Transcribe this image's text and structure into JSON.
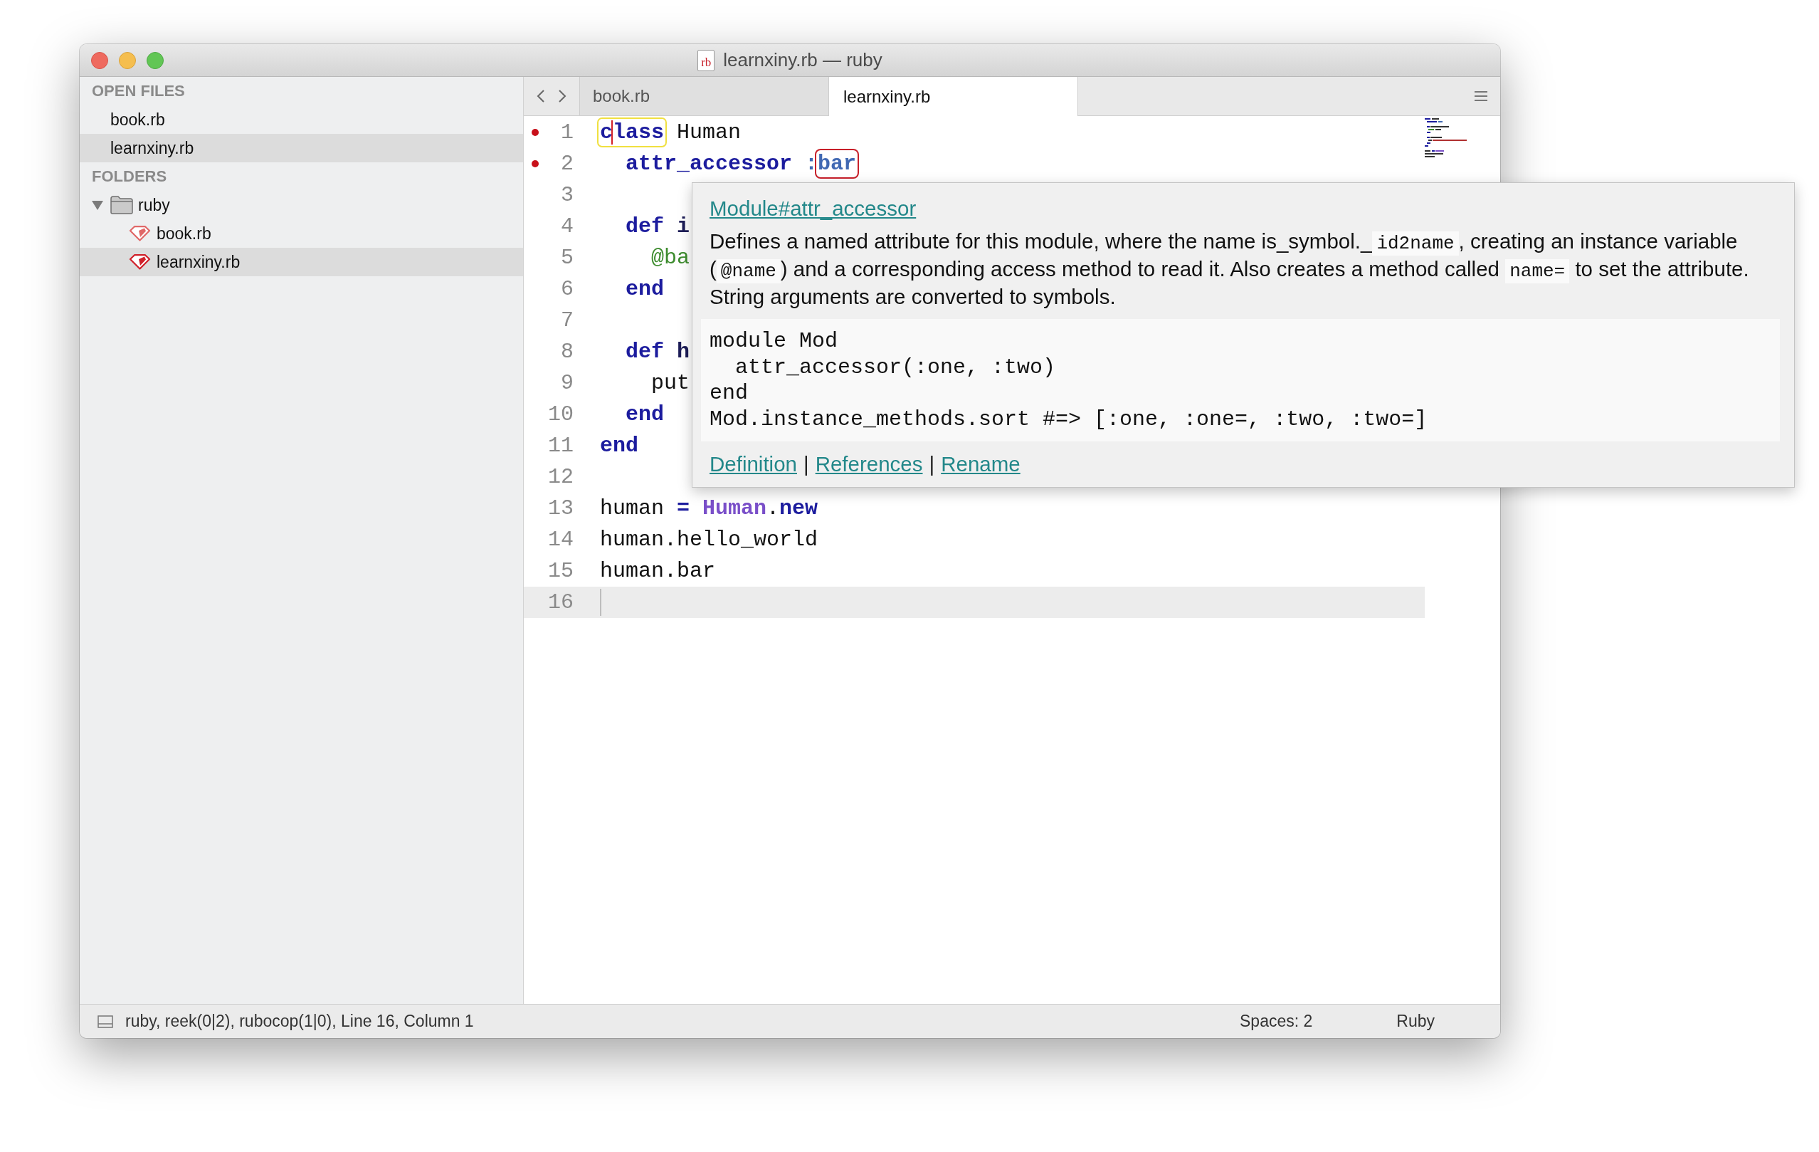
{
  "window": {
    "title": "learnxiny.rb — ruby",
    "file_icon_text": "rb"
  },
  "sidebar": {
    "sections": [
      {
        "kind": "open-files",
        "title": "OPEN FILES",
        "items": [
          {
            "label": "book.rb",
            "selected": false
          },
          {
            "label": "learnxiny.rb",
            "selected": true
          }
        ]
      },
      {
        "kind": "folders",
        "title": "FOLDERS",
        "items": [
          {
            "label": "ruby",
            "kind": "folder",
            "expanded": true,
            "selected": false,
            "children": [
              {
                "label": "book.rb",
                "kind": "ruby-file",
                "selected": false
              },
              {
                "label": "learnxiny.rb",
                "kind": "ruby-file",
                "selected": true
              }
            ]
          }
        ]
      }
    ]
  },
  "tabs": [
    {
      "label": "book.rb",
      "selected": false
    },
    {
      "label": "learnxiny.rb",
      "selected": true
    }
  ],
  "editor": {
    "lines": [
      {
        "number": "1",
        "marker": true,
        "current": false,
        "tokens": [
          {
            "text": "class ",
            "kind": "keyword",
            "matched": true,
            "flagged": false,
            "caret": true
          },
          {
            "text": "Human",
            "kind": "plain",
            "matched": false,
            "flagged": false,
            "caret": false
          }
        ]
      },
      {
        "number": "2",
        "marker": true,
        "current": false,
        "tokens": [
          {
            "text": "  attr_accessor ",
            "kind": "keyword",
            "matched": false,
            "flagged": false,
            "caret": false
          },
          {
            "text": ":",
            "kind": "symbol",
            "matched": false,
            "flagged": false,
            "caret": false
          },
          {
            "text": "bar",
            "kind": "symbol",
            "matched": false,
            "flagged": true,
            "caret": false
          }
        ]
      },
      {
        "number": "3",
        "marker": false,
        "current": false
      },
      {
        "number": "4",
        "marker": false,
        "current": false,
        "tokens": [
          {
            "text": "  def ",
            "kind": "keyword",
            "matched": false,
            "flagged": false,
            "caret": false
          },
          {
            "text": "i",
            "kind": "entity",
            "matched": false,
            "flagged": false,
            "caret": false
          }
        ]
      },
      {
        "number": "5",
        "marker": false,
        "current": false,
        "tokens": [
          {
            "text": "    @ba",
            "kind": "ivar",
            "matched": false,
            "flagged": false,
            "caret": false
          }
        ]
      },
      {
        "number": "6",
        "marker": false,
        "current": false,
        "tokens": [
          {
            "text": "  end",
            "kind": "keyword",
            "matched": false,
            "flagged": false,
            "caret": false
          }
        ]
      },
      {
        "number": "7",
        "marker": false,
        "current": false
      },
      {
        "number": "8",
        "marker": false,
        "current": false,
        "tokens": [
          {
            "text": "  def ",
            "kind": "keyword",
            "matched": false,
            "flagged": false,
            "caret": false
          },
          {
            "text": "h",
            "kind": "entity",
            "matched": false,
            "flagged": false,
            "caret": false
          }
        ]
      },
      {
        "number": "9",
        "marker": false,
        "current": false,
        "tokens": [
          {
            "text": "    put",
            "kind": "plain",
            "matched": false,
            "flagged": false,
            "caret": false
          }
        ]
      },
      {
        "number": "10",
        "marker": false,
        "current": false,
        "tokens": [
          {
            "text": "  end",
            "kind": "keyword",
            "matched": false,
            "flagged": false,
            "caret": false
          }
        ]
      },
      {
        "number": "11",
        "marker": false,
        "current": false,
        "tokens": [
          {
            "text": "end",
            "kind": "keyword",
            "matched": false,
            "flagged": false,
            "caret": false
          }
        ]
      },
      {
        "number": "12",
        "marker": false,
        "current": false
      },
      {
        "number": "13",
        "marker": false,
        "current": false,
        "tokens": [
          {
            "text": "human ",
            "kind": "plain",
            "matched": false,
            "flagged": false,
            "caret": false
          },
          {
            "text": "= ",
            "kind": "keyword",
            "matched": false,
            "flagged": false,
            "caret": false
          },
          {
            "text": "Human",
            "kind": "constant",
            "matched": false,
            "flagged": false,
            "caret": false
          },
          {
            "text": ".",
            "kind": "plain",
            "matched": false,
            "flagged": false,
            "caret": false
          },
          {
            "text": "new",
            "kind": "keyword",
            "matched": false,
            "flagged": false,
            "caret": false
          }
        ]
      },
      {
        "number": "14",
        "marker": false,
        "current": false,
        "tokens": [
          {
            "text": "human.hello_world",
            "kind": "plain",
            "matched": false,
            "flagged": false,
            "caret": false
          }
        ]
      },
      {
        "number": "15",
        "marker": false,
        "current": false,
        "tokens": [
          {
            "text": "human.bar",
            "kind": "plain",
            "matched": false,
            "flagged": false,
            "caret": false
          }
        ]
      },
      {
        "number": "16",
        "marker": false,
        "current": true
      }
    ]
  },
  "popup": {
    "title": "Module#attr_accessor",
    "description": [
      {
        "text": "Defines a named attribute for this module, where the name is_symbol._",
        "kind": "text"
      },
      {
        "text": "id2name",
        "kind": "code"
      },
      {
        "text": ", creating an instance variable (",
        "kind": "text"
      },
      {
        "text": "@name",
        "kind": "code"
      },
      {
        "text": ") and a corresponding access method to read it. Also creates a method called ",
        "kind": "text"
      },
      {
        "text": "name=",
        "kind": "code"
      },
      {
        "text": " to set the attribute. String arguments are converted to symbols.",
        "kind": "text"
      }
    ],
    "code": [
      "module Mod",
      "  attr_accessor(:one, :two)",
      "end",
      "Mod.instance_methods.sort #=> [:one, :one=, :two, :two=]"
    ],
    "footer": [
      {
        "kind": "link",
        "text": "Definition"
      },
      {
        "kind": "separator",
        "text": "|"
      },
      {
        "kind": "link",
        "text": "References"
      },
      {
        "kind": "separator",
        "text": "|"
      },
      {
        "kind": "link",
        "text": "Rename"
      }
    ]
  },
  "status_bar": {
    "text": "ruby, reek(0|2), rubocop(1|0), Line 16, Column 1",
    "items": [
      {
        "label": "Spaces: 2"
      },
      {
        "label": "Ruby"
      }
    ]
  }
}
